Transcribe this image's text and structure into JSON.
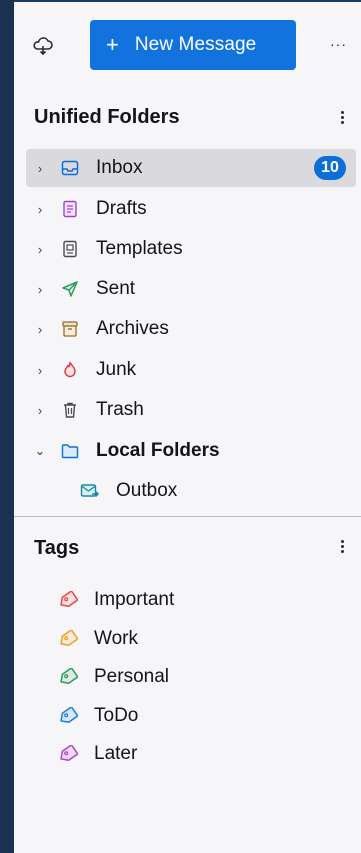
{
  "toolbar": {
    "new_message_label": "New Message",
    "plus_glyph": "+",
    "more_glyph": "···",
    "sync_icon": "cloud-sync-icon"
  },
  "folders_pane": {
    "title": "Unified Folders",
    "folders": [
      {
        "name": "Inbox",
        "icon": "inbox-icon",
        "twisty": "›",
        "badge": "10",
        "selected": true,
        "color": "#0b6fd6"
      },
      {
        "name": "Drafts",
        "icon": "drafts-icon",
        "twisty": "›",
        "color": "#a33fd4"
      },
      {
        "name": "Templates",
        "icon": "templates-icon",
        "twisty": "›",
        "color": "#4a4a55"
      },
      {
        "name": "Sent",
        "icon": "sent-icon",
        "twisty": "›",
        "color": "#2e9b5c"
      },
      {
        "name": "Archives",
        "icon": "archives-icon",
        "twisty": "›",
        "color": "#9a6a2f"
      },
      {
        "name": "Junk",
        "icon": "junk-icon",
        "twisty": "›",
        "color": "#d73a49"
      },
      {
        "name": "Trash",
        "icon": "trash-icon",
        "twisty": "›",
        "color": "#4a4a55"
      },
      {
        "name": "Local Folders",
        "icon": "folder-icon",
        "twisty": "⌄",
        "bold": true,
        "color": "#0b6fd6"
      }
    ],
    "subfolders": [
      {
        "name": "Outbox",
        "icon": "outbox-icon",
        "color": "#1a8a9a"
      }
    ]
  },
  "tags_pane": {
    "title": "Tags",
    "tags": [
      {
        "name": "Important",
        "icon": "tag-icon",
        "color": "#e5484d"
      },
      {
        "name": "Work",
        "icon": "tag-icon",
        "color": "#f0a020"
      },
      {
        "name": "Personal",
        "icon": "tag-icon",
        "color": "#2e9b5c"
      },
      {
        "name": "ToDo",
        "icon": "tag-icon",
        "color": "#1d7ee0"
      },
      {
        "name": "Later",
        "icon": "tag-icon",
        "color": "#b33fd4"
      }
    ]
  },
  "colors": {
    "accent": "#1273de",
    "sidebar_bg": "#f6f6f8",
    "window_frame": "#1c3152",
    "selected_row": "#d9d9de"
  }
}
